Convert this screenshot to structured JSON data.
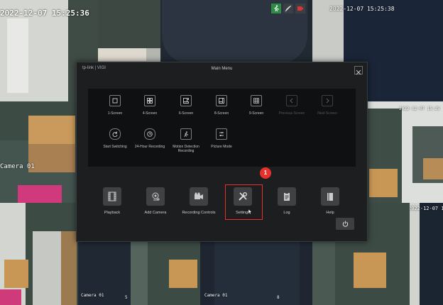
{
  "camera_grid": {
    "tile1_timestamp": "2022-12-07 15:25:36",
    "tile2_timestamp": "2022-12-07 15:25:38",
    "tile_left_mid_caption": "Camera 01",
    "tile_right_mid_timestamp": "2022-12-07 15:25",
    "tile_right_bottom_timestamp": "2022-12-07 15",
    "tile_bottom1_caption": "Camera 01",
    "tile_bottom1_id": "5",
    "tile_bottom3_caption": "Camera 01",
    "tile_bottom3_id": "8",
    "status_icons": [
      "motion-icon",
      "no-sound-icon",
      "recording-icon"
    ]
  },
  "modal": {
    "logo_text": "tp-link | VIGI",
    "title": "Main Menu",
    "tools": [
      {
        "label": "1-Screen",
        "icon": "square-1-icon"
      },
      {
        "label": "4-Screen",
        "icon": "square-4-icon"
      },
      {
        "label": "6-Screen",
        "icon": "square-6-icon"
      },
      {
        "label": "8-Screen",
        "icon": "square-8-icon"
      },
      {
        "label": "9-Screen",
        "icon": "square-9-icon"
      },
      {
        "label": "Previous Screen",
        "icon": "chevron-left-icon"
      },
      {
        "label": "Next Screen",
        "icon": "chevron-right-icon"
      },
      {
        "label": "Start Switching",
        "icon": "rotate-icon"
      },
      {
        "label": "24-Hour Recording",
        "icon": "clock-icon"
      },
      {
        "label": "Motion Detection Recording",
        "icon": "running-icon"
      },
      {
        "label": "Picture Mode",
        "icon": "sliders-icon"
      }
    ],
    "items": [
      {
        "label": "Playback",
        "icon": "film-icon"
      },
      {
        "label": "Add Camera",
        "icon": "camera-add-icon"
      },
      {
        "label": "Recording Controls",
        "icon": "video-camera-icon"
      },
      {
        "label": "Settings",
        "icon": "wrench-screwdriver-icon"
      },
      {
        "label": "Log",
        "icon": "clipboard-icon"
      },
      {
        "label": "Help",
        "icon": "book-icon"
      }
    ],
    "annotation_number": "1",
    "power_icon": "power-icon"
  },
  "colors": {
    "highlight": "#e8312d",
    "modal_bg": "#1d1e20",
    "panel_bg": "#0f1011"
  }
}
